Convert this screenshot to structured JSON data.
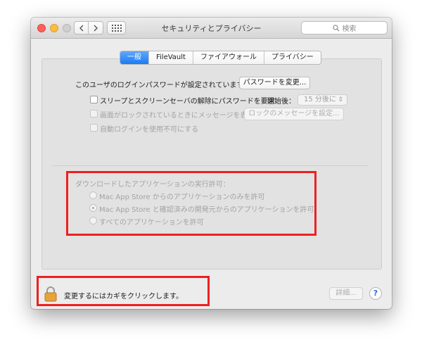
{
  "window": {
    "title": "セキュリティとプライバシー",
    "search_placeholder": "検索"
  },
  "tabs": [
    {
      "label": "一般",
      "active": true
    },
    {
      "label": "FileVault",
      "active": false
    },
    {
      "label": "ファイアウォール",
      "active": false
    },
    {
      "label": "プライバシー",
      "active": false
    }
  ],
  "general": {
    "password_status": "このユーザのログインパスワードが設定されています",
    "change_password_button": "パスワードを変更...",
    "require_password_label": "スリープとスクリーンセーバの解除にパスワードを要求",
    "start_after_label": "開始後：",
    "start_after_value": "15 分後に",
    "lock_message_label": "画面がロックされているときにメッセージを表示",
    "lock_message_button": "ロックのメッセージを設定...",
    "disable_autologin_label": "自動ログインを使用不可にする"
  },
  "downloads": {
    "heading": "ダウンロードしたアプリケーションの実行許可：",
    "options": [
      {
        "label": "Mac App Store からのアプリケーションのみを許可",
        "selected": false
      },
      {
        "label": "Mac App Store と確認済みの開発元からのアプリケーションを許可",
        "selected": true
      },
      {
        "label": "すべてのアプリケーションを許可",
        "selected": false
      }
    ]
  },
  "footer": {
    "lock_text": "変更するにはカギをクリックします。",
    "advanced_button": "詳細...",
    "help_label": "?"
  },
  "colors": {
    "active_tab": "#1b7bf5",
    "highlight_box": "#ee2020",
    "close_light": "#fc605c",
    "minimize_light": "#fdbc40",
    "lock_body": "#e9a23b"
  },
  "icons": [
    "back-chevron-icon",
    "forward-chevron-icon",
    "grid-icon",
    "search-icon",
    "lock-icon",
    "help-icon"
  ]
}
